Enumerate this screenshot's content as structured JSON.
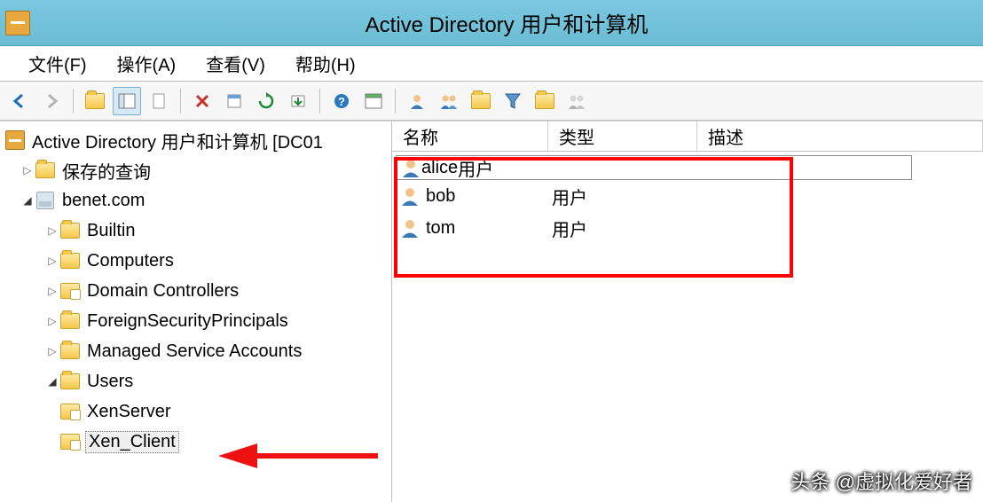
{
  "window": {
    "title": "Active Directory 用户和计算机"
  },
  "menu": {
    "file": "文件(F)",
    "action": "操作(A)",
    "view": "查看(V)",
    "help": "帮助(H)"
  },
  "tree": {
    "root": "Active Directory 用户和计算机 [DC01",
    "saved_queries": "保存的查询",
    "domain": "benet.com",
    "builtin": "Builtin",
    "computers": "Computers",
    "domain_controllers": "Domain Controllers",
    "fsp": "ForeignSecurityPrincipals",
    "msa": "Managed Service Accounts",
    "users": "Users",
    "xenserver": "XenServer",
    "xen_client": "Xen_Client"
  },
  "columns": {
    "name": "名称",
    "type": "类型",
    "desc": "描述"
  },
  "rows": [
    {
      "name": "alice",
      "type": "用户"
    },
    {
      "name": "bob",
      "type": "用户"
    },
    {
      "name": "tom",
      "type": "用户"
    }
  ],
  "watermark": "头条 @虚拟化爱好者"
}
